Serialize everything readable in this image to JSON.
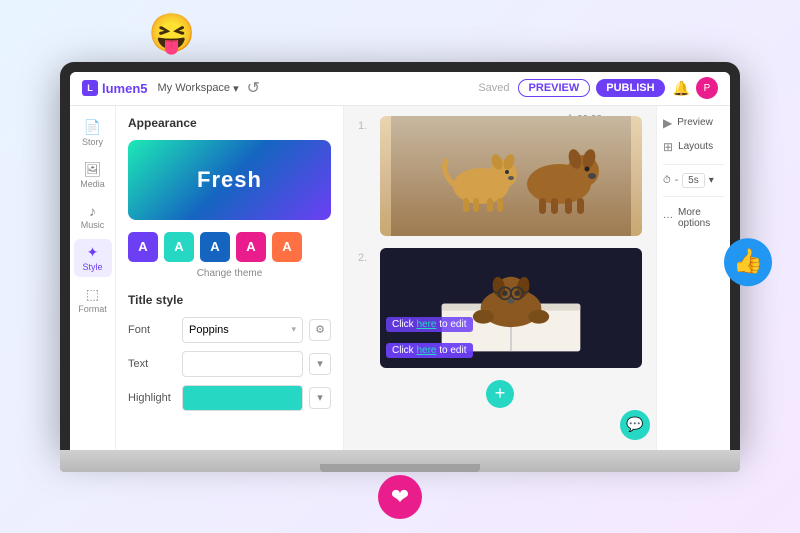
{
  "scene": {
    "emoji_laugh": "😝",
    "thumbs_up": "👍",
    "heart": "❤️"
  },
  "topbar": {
    "logo_text": "lumen5",
    "workspace_label": "My Workspace",
    "chevron": "▾",
    "undo_symbol": "↺",
    "saved_label": "Saved",
    "preview_label": "PREVIEW",
    "publish_label": "PUBLISH",
    "avatar_letter": "P"
  },
  "sidebar": {
    "items": [
      {
        "icon": "📖",
        "label": "Story"
      },
      {
        "icon": "🖼",
        "label": "Media"
      },
      {
        "icon": "♪",
        "label": "Music"
      },
      {
        "icon": "✦",
        "label": "Style"
      },
      {
        "icon": "⬚",
        "label": "Format"
      }
    ],
    "active_index": 3
  },
  "left_panel": {
    "appearance_title": "Appearance",
    "theme_card_label": "Fresh",
    "swatches": [
      {
        "letter": "A",
        "color": "#6c3ff5"
      },
      {
        "letter": "A",
        "color": "#26d7c4"
      },
      {
        "letter": "A",
        "color": "#1565c0"
      },
      {
        "letter": "A",
        "color": "#e91e8c"
      },
      {
        "letter": "A",
        "color": "#ff7043"
      }
    ],
    "change_theme_label": "Change theme",
    "title_style_label": "Title style",
    "font_label": "Font",
    "font_value": "Poppins",
    "text_label": "Text",
    "highlight_label": "Highlight"
  },
  "canvas": {
    "timer_icon": "⏱",
    "timer_value": "00:08",
    "slide1_number": "1.",
    "slide2_number": "2.",
    "dog_emoji": "🐕",
    "dog_book_emoji": "🐶",
    "click_here_text1": "Click here to edit",
    "click_here_text2": "Click here to edit",
    "add_slide_icon": "+"
  },
  "right_sidebar": {
    "preview_label": "Preview",
    "layouts_label": "Layouts",
    "timer_label": "5s",
    "more_label": "More options",
    "chat_icon": "💬"
  }
}
